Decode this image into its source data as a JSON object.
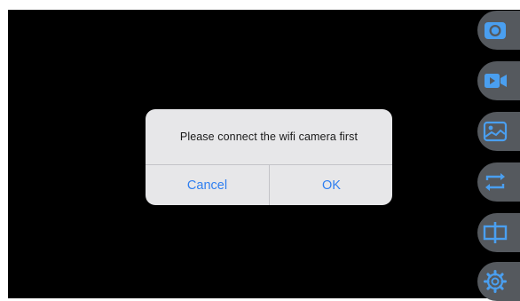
{
  "dialog": {
    "message": "Please connect the wifi camera first",
    "cancel_label": "Cancel",
    "ok_label": "OK"
  },
  "toolbar": {
    "items": [
      {
        "name": "photo-capture",
        "icon": "camera-icon"
      },
      {
        "name": "video-record",
        "icon": "video-camera-icon"
      },
      {
        "name": "gallery",
        "icon": "image-icon"
      },
      {
        "name": "flip-camera",
        "icon": "swap-arrows-icon"
      },
      {
        "name": "split-view",
        "icon": "split-view-icon"
      },
      {
        "name": "settings",
        "icon": "gear-icon"
      }
    ]
  },
  "colors": {
    "background": "#000000",
    "dialog_background": "#e7e7e9",
    "accent": "#2f7ff0",
    "tool_button": "#55595e",
    "tool_icon": "#4a9ff0"
  }
}
